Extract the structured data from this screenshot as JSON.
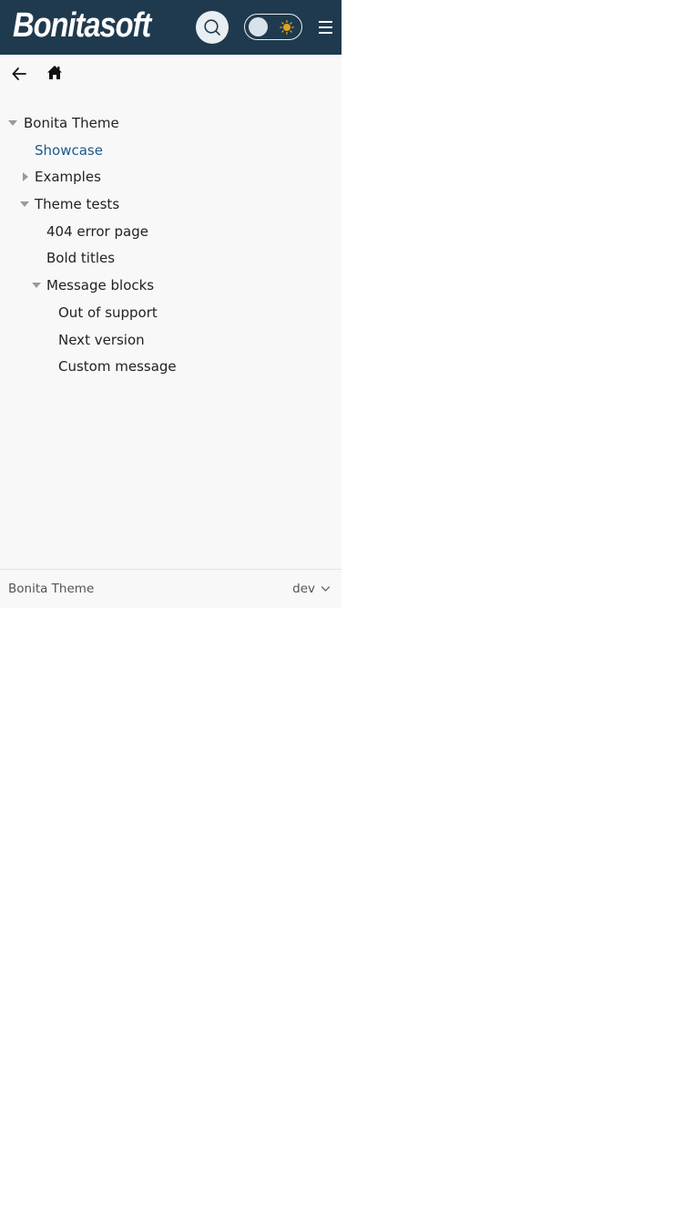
{
  "header": {
    "logo_text": "Bonitasoft",
    "search_icon": "search-icon",
    "theme_toggle_icon": "sun-icon",
    "menu_icon": "hamburger-menu-icon",
    "colors": {
      "navbar_bg": "#1f3a4e",
      "sun": "#e8a21a"
    }
  },
  "subnav": {
    "back_icon": "arrow-left-icon",
    "home_icon": "home-icon"
  },
  "nav_tree": {
    "root": "Bonita Theme",
    "showcase": "Showcase",
    "examples": "Examples",
    "theme_tests": "Theme tests",
    "error_404": "404 error page",
    "bold_titles": "Bold titles",
    "message_blocks": "Message blocks",
    "out_of_support": "Out of support",
    "next_version": "Next version",
    "custom_message": "Custom message",
    "active_color": "#1a5a8c"
  },
  "footer": {
    "component_title": "Bonita Theme",
    "version": "dev"
  }
}
